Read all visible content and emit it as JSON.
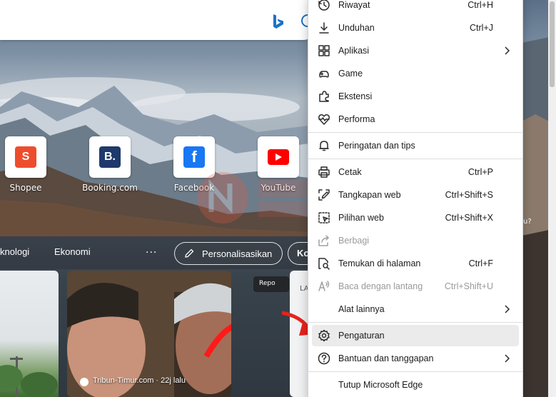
{
  "address_bar": {
    "icons": [
      "bing-icon",
      "search-icon"
    ]
  },
  "quick_links": [
    {
      "label": "Shopee",
      "icon": "shopee-icon",
      "color": "#ee4d2d"
    },
    {
      "label": "Booking.com",
      "icon": "booking-icon",
      "color": "#1f3a6b"
    },
    {
      "label": "Facebook",
      "icon": "facebook-icon",
      "color": "#1877f2"
    },
    {
      "label": "YouTube",
      "icon": "youtube-icon",
      "color": "#ff0000"
    }
  ],
  "feed_nav": {
    "items": [
      "knologi",
      "Ekonomi"
    ],
    "more": "···",
    "personalize_label": "Personalisasikan",
    "next_button_label": "Ko"
  },
  "news": {
    "report_label": "Repo",
    "source": "Tribun-Timur.com · 22j lalu",
    "right_card_text": "LA"
  },
  "right_strip_text": "u?",
  "menu": {
    "items": [
      {
        "label": "Riwayat",
        "shortcut": "Ctrl+H",
        "icon": "history-icon"
      },
      {
        "label": "Unduhan",
        "shortcut": "Ctrl+J",
        "icon": "download-icon"
      },
      {
        "label": "Aplikasi",
        "shortcut": "",
        "icon": "apps-icon",
        "submenu": true
      },
      {
        "label": "Game",
        "shortcut": "",
        "icon": "game-icon"
      },
      {
        "label": "Ekstensi",
        "shortcut": "",
        "icon": "extensions-icon"
      },
      {
        "label": "Performa",
        "shortcut": "",
        "icon": "performance-icon"
      },
      {
        "label": "Peringatan dan tips",
        "shortcut": "",
        "icon": "bell-icon"
      },
      {
        "label": "Cetak",
        "shortcut": "Ctrl+P",
        "icon": "print-icon"
      },
      {
        "label": "Tangkapan web",
        "shortcut": "Ctrl+Shift+S",
        "icon": "web-capture-icon"
      },
      {
        "label": "Pilihan web",
        "shortcut": "Ctrl+Shift+X",
        "icon": "web-select-icon"
      },
      {
        "label": "Berbagi",
        "shortcut": "",
        "icon": "share-icon",
        "disabled": true
      },
      {
        "label": "Temukan di halaman",
        "shortcut": "Ctrl+F",
        "icon": "find-icon"
      },
      {
        "label": "Baca dengan lantang",
        "shortcut": "Ctrl+Shift+U",
        "icon": "read-aloud-icon",
        "disabled": true
      },
      {
        "label": "Alat lainnya",
        "shortcut": "",
        "icon": "",
        "submenu": true
      },
      {
        "label": "Pengaturan",
        "shortcut": "",
        "icon": "settings-icon",
        "highlighted": true
      },
      {
        "label": "Bantuan dan tanggapan",
        "shortcut": "",
        "icon": "help-icon",
        "submenu": true
      },
      {
        "label": "Tutup Microsoft Edge",
        "shortcut": "",
        "icon": ""
      }
    ]
  }
}
